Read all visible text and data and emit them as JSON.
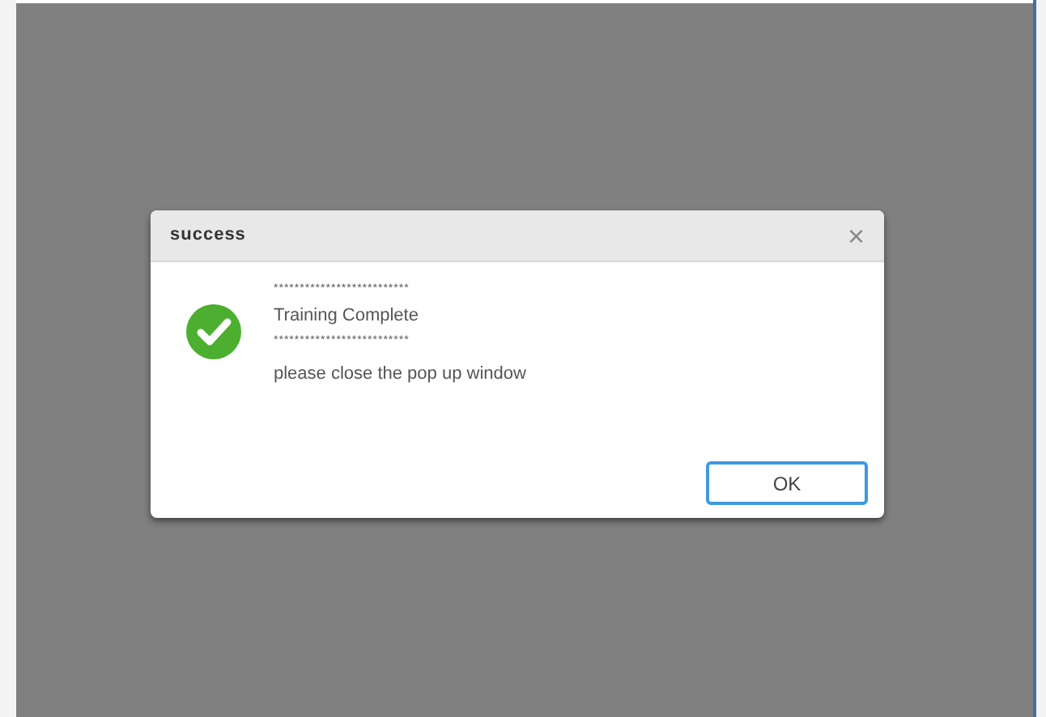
{
  "dialog": {
    "title": "success",
    "close_label": "×",
    "message_lines": [
      "**************************",
      "Training Complete",
      "**************************",
      "please close the pop up window"
    ],
    "buttons": [
      {
        "label": "OK",
        "focused": true
      }
    ]
  }
}
